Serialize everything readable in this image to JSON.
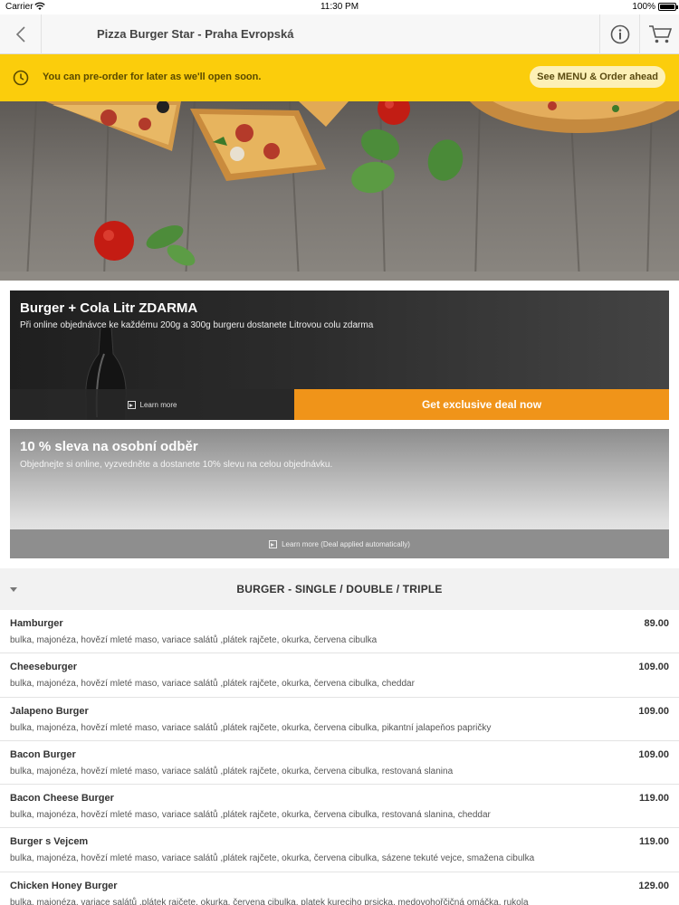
{
  "status_bar": {
    "carrier": "Carrier",
    "time": "11:30 PM",
    "battery": "100%"
  },
  "nav": {
    "title": "Pizza Burger Star - Praha Evropská"
  },
  "notice": {
    "text": "You can pre-order for later as we'll open soon.",
    "cta": "See MENU & Order ahead"
  },
  "deals": [
    {
      "title": "Burger + Cola Litr ZDARMA",
      "description": "Při online objednávce ke každému 200g a 300g burgeru dostanete Litrovou colu zdarma",
      "learn_more": "Learn more",
      "cta": "Get exclusive deal now"
    },
    {
      "title": "10 % sleva na osobní odběr",
      "description": "Objednejte si online, vyzvedněte a dostanete 10% slevu na celou objednávku.",
      "learn_more": "Learn more (Deal applied automatically)"
    }
  ],
  "category": {
    "name": "BURGER - SINGLE / DOUBLE / TRIPLE"
  },
  "items": [
    {
      "name": "Hamburger",
      "price": "89.00",
      "desc": "bulka, majonéza, hovězí mleté maso, variace salátů ,plátek rajčete, okurka, červena cibulka"
    },
    {
      "name": "Cheeseburger",
      "price": "109.00",
      "desc": "bulka, majonéza, hovězí mleté maso, variace salátů ,plátek rajčete, okurka, červena cibulka, cheddar"
    },
    {
      "name": "Jalapeno Burger",
      "price": "109.00",
      "desc": "bulka, majonéza, hovězí mleté maso, variace salátů ,plátek rajčete, okurka, červena cibulka, pikantní jalapeňos papričky"
    },
    {
      "name": "Bacon Burger",
      "price": "109.00",
      "desc": "bulka, majonéza, hovězí mleté maso, variace salátů ,plátek rajčete, okurka, červena cibulka, restovaná slanina"
    },
    {
      "name": "Bacon Cheese Burger",
      "price": "119.00",
      "desc": "bulka, majonéza, hovězí mleté maso, variace salátů ,plátek rajčete, okurka, červena cibulka, restovaná slanina, cheddar"
    },
    {
      "name": "Burger s Vejcem",
      "price": "119.00",
      "desc": "bulka, majonéza, hovězí mleté maso, variace salátů ,plátek rajčete, okurka, červena cibulka, sázene tekuté vejce, smažena cibulka"
    },
    {
      "name": "Chicken Honey Burger",
      "price": "129.00",
      "desc": "bulka, majonéza, variace salátů ,plátek rajčete, okurka, červena cibulka, platek kureciho prsicka, medovohořčičná omáčka, rukola"
    }
  ],
  "colors": {
    "accent_yellow": "#fbcd0c",
    "deal_orange": "#f09419"
  }
}
